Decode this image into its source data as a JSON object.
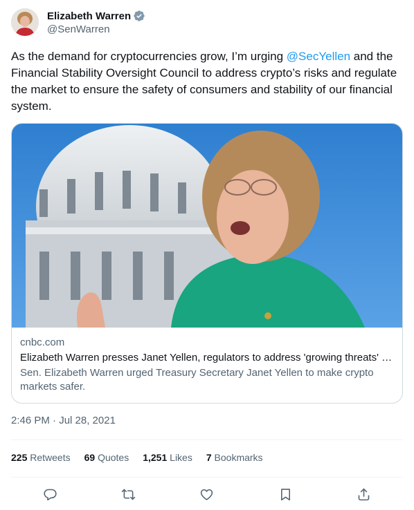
{
  "author": {
    "display_name": "Elizabeth Warren",
    "handle": "@SenWarren",
    "verified": true
  },
  "tweet": {
    "text_before": "As the demand for cryptocurrencies grow, I’m urging ",
    "mention": "@SecYellen",
    "text_after": " and the Financial Stability Oversight Council to address crypto’s risks and regulate the market to ensure the safety of consumers and stability of our financial system."
  },
  "card": {
    "domain": "cnbc.com",
    "title": "Elizabeth Warren presses Janet Yellen, regulators to address 'growing threats' from crypto",
    "description": "Sen. Elizabeth Warren urged Treasury Secretary Janet Yellen to make crypto markets safer."
  },
  "timestamp": "2:46 PM · Jul 28, 2021",
  "stats": [
    {
      "count": "225",
      "label": "Retweets"
    },
    {
      "count": "69",
      "label": "Quotes"
    },
    {
      "count": "1,251",
      "label": "Likes"
    },
    {
      "count": "7",
      "label": "Bookmarks"
    }
  ],
  "colors": {
    "accent": "#1d9bf0",
    "secondary_text": "#536471",
    "border": "#cfd9de"
  },
  "icons": [
    "verified-badge-icon",
    "reply-icon",
    "retweet-icon",
    "like-icon",
    "bookmark-icon",
    "share-icon"
  ]
}
